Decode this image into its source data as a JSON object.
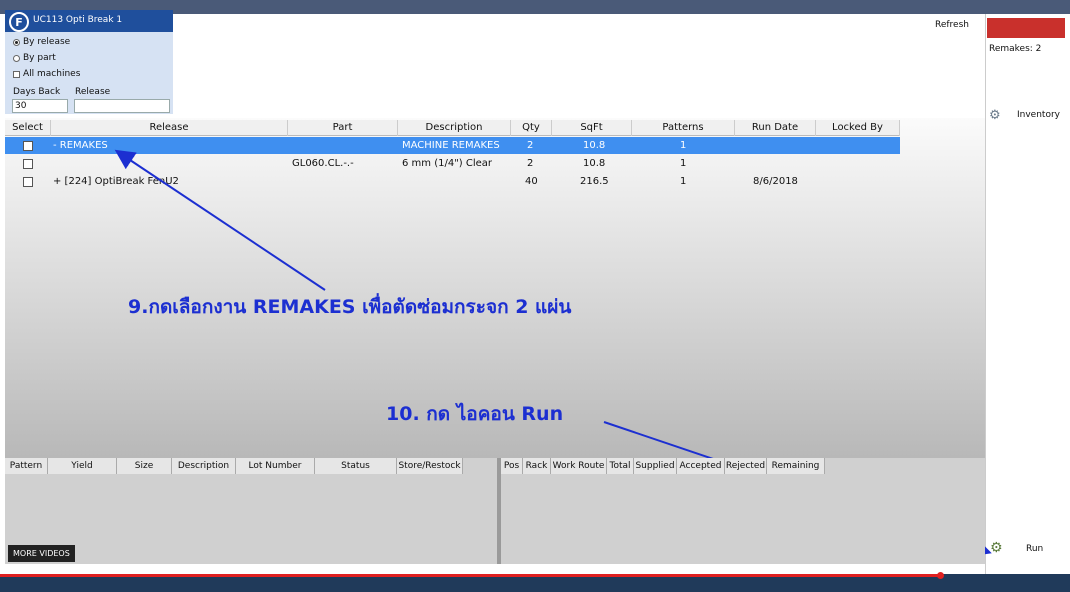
{
  "app": {
    "title": "UC113 Opti Break 1"
  },
  "filters": {
    "by_release": "By release",
    "by_part": "By part",
    "all_machines": "All machines",
    "days_back_label": "Days Back",
    "release_label": "Release",
    "days_back_value": "30",
    "release_value": ""
  },
  "toolbar": {
    "refresh": "Refresh"
  },
  "right": {
    "remakes": "Remakes: 2",
    "inventory": "Inventory",
    "run": "Run"
  },
  "grid": {
    "columns": [
      "Select",
      "Release",
      "Part",
      "Description",
      "Qty",
      "SqFt",
      "Patterns",
      "Run Date",
      "Locked By"
    ],
    "rows": [
      {
        "release": "- REMAKES",
        "part": "",
        "description": "MACHINE REMAKES",
        "qty": "2",
        "sqft": "10.8",
        "patterns": "1",
        "run_date": ""
      },
      {
        "release": "",
        "part": "GL060.CL.-.-",
        "description": "6 mm (1/4\") Clear",
        "qty": "2",
        "sqft": "10.8",
        "patterns": "1",
        "run_date": ""
      },
      {
        "release": "+ [224] OptiBreak FenU2",
        "part": "",
        "description": "",
        "qty": "40",
        "sqft": "216.5",
        "patterns": "1",
        "run_date": "8/6/2018"
      }
    ]
  },
  "bottom_left_columns": [
    "Pattern",
    "Yield",
    "Size",
    "Description",
    "Lot Number",
    "Status",
    "Store/Restock"
  ],
  "bottom_right_columns": [
    "Pos",
    "Rack",
    "Work Route",
    "Total",
    "Supplied",
    "Accepted",
    "Rejected",
    "Remaining"
  ],
  "annotations": {
    "step9": "9.กดเลือกงาน REMAKES เพื่อตัดซ่อมกระจก 2 แผ่น",
    "step10": "10. กด ไอคอน Run"
  },
  "footer": {
    "more_videos": "MORE VIDEOS"
  }
}
